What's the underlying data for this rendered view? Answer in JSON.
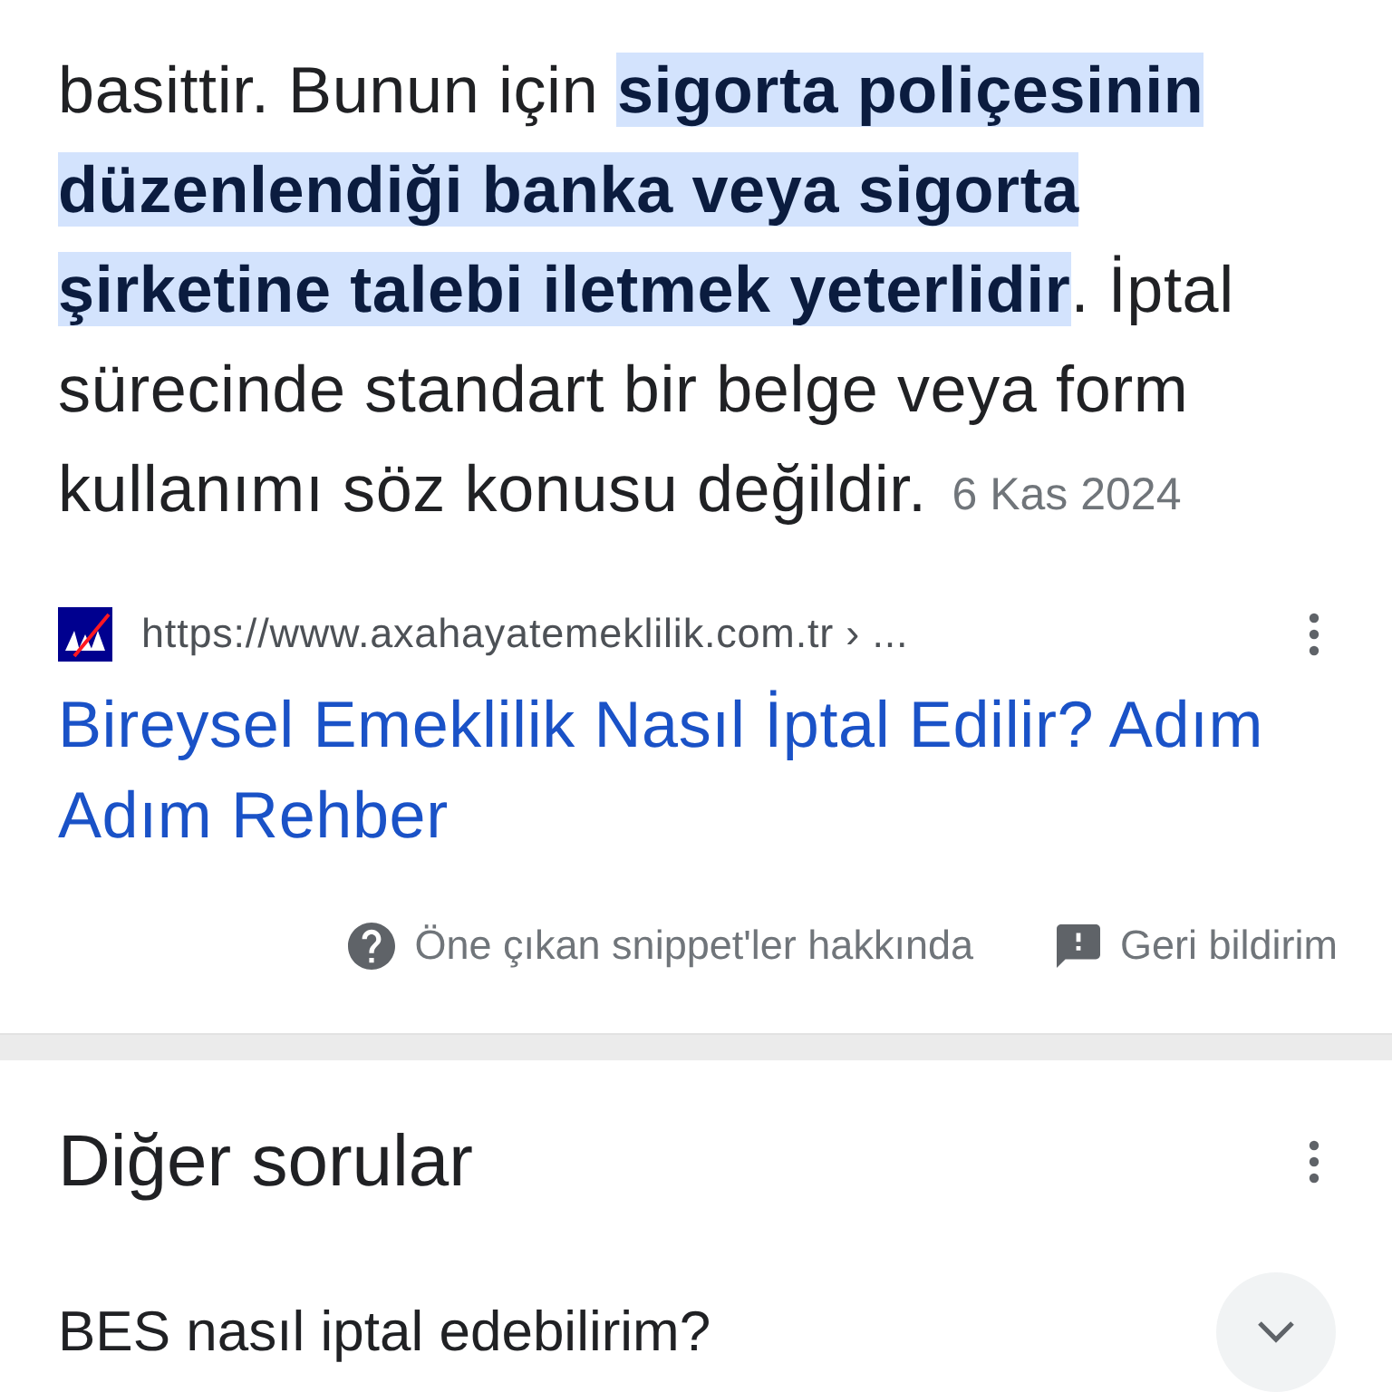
{
  "snippet": {
    "text": "basittir. Bunun için **sigorta poliçesinin düzenlendiği banka veya sigorta şirketine talebi iletmek yeterlidir**. İptal sürecinde standart bir belge veya form kullanımı söz konusu değildir.",
    "date": "6 Kas 2024"
  },
  "source": {
    "url": "https://www.axahayatemeklilik.com.tr › ...",
    "title": "Bireysel Emeklilik Nasıl İptal Edilir? Adım Adım Rehber"
  },
  "footer_links": [
    {
      "kind": "about",
      "label": "Öne çıkan snippet'ler hakkında"
    },
    {
      "kind": "feedback",
      "label": "Geri bildirim"
    }
  ],
  "related_questions": {
    "title": "Diğer sorular",
    "items": [
      {
        "question": "BES nasıl iptal edebilirim?",
        "expanded": false
      }
    ]
  }
}
